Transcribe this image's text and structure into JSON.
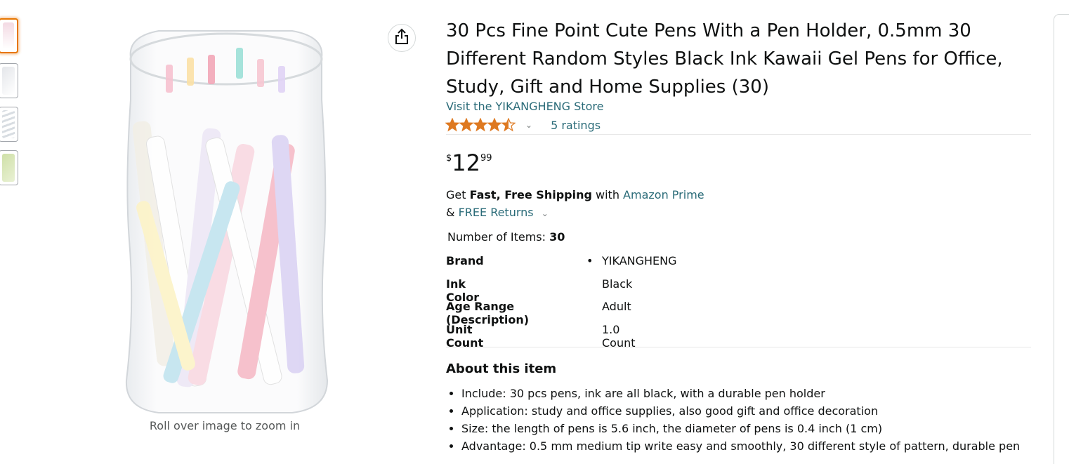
{
  "gallery": {
    "thumbnails": [
      {
        "label": "thumb-1",
        "color": "#f3d9e3"
      },
      {
        "label": "thumb-2",
        "color": "#e4e6ea"
      },
      {
        "label": "thumb-3",
        "color": "#e9eef2"
      },
      {
        "label": "thumb-4",
        "color": "#cfe0a8"
      }
    ],
    "zoom_hint": "Roll over image to zoom in"
  },
  "product": {
    "title": "30 Pcs Fine Point Cute Pens With a Pen Holder, 0.5mm 30 Different Random Styles Black Ink Kawaii Gel Pens for Office, Study, Gift and Home Supplies (30)",
    "store_link": "Visit the YIKANGHENG Store",
    "rating_value": 4.5,
    "ratings_count": "5 ratings",
    "price": {
      "symbol": "$",
      "whole": "12",
      "fraction": "99"
    },
    "shipping": {
      "prefix": "Get ",
      "bold": "Fast, Free Shipping",
      "mid": " with ",
      "prime_link": "Amazon Prime",
      "amp": "& ",
      "returns_link": "FREE Returns"
    },
    "number_of_items": {
      "label": "Number of Items: ",
      "value": "30"
    },
    "specs": [
      {
        "key": "Brand",
        "value": "YIKANGHENG",
        "bullet": "•"
      },
      {
        "key": "Ink Color",
        "value": "Black",
        "bullet": ""
      },
      {
        "key": "Age Range (Description)",
        "value": "Adult",
        "bullet": ""
      },
      {
        "key": "Unit Count",
        "value": "1.0 Count",
        "bullet": ""
      }
    ],
    "about_heading": "About this item",
    "about_items": [
      "Include: 30 pcs pens, ink are all black, with a durable pen holder",
      "Application: study and office supplies, also good gift and office decoration",
      "Size: the length of pens is 5.6 inch, the diameter of pens is 0.4 inch (1 cm)",
      "Advantage: 0.5 mm medium tip write easy and smoothly, 30 different style of pattern, durable pen"
    ]
  },
  "colors": {
    "accent": "#e77600",
    "link": "#2a6b78",
    "star": "#de7921"
  },
  "icons": {
    "share": "share-icon",
    "star": "star-icon",
    "chevron": "chevron-down-icon"
  }
}
